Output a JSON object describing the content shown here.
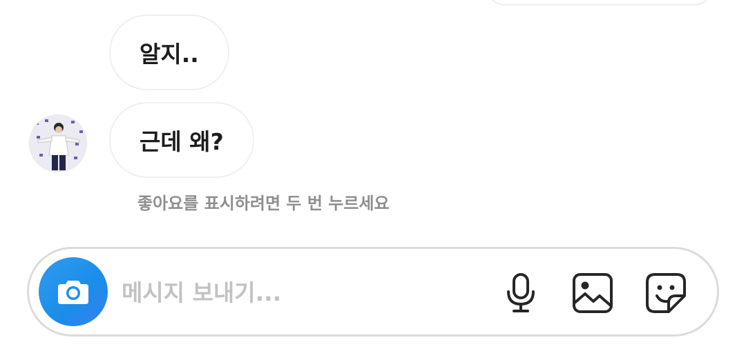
{
  "messages": [
    {
      "text": "알지.."
    },
    {
      "text": "근데 왜?"
    }
  ],
  "hint": "좋아요를 표시하려면 두 번 누르세요",
  "composer": {
    "placeholder": "메시지 보내기...",
    "icons": [
      "camera-icon",
      "microphone-icon",
      "gallery-icon",
      "sticker-icon"
    ]
  },
  "colors": {
    "camera_button": "#1a8de9",
    "bubble_border": "#efefef",
    "hint_text": "#8e8e8e",
    "placeholder": "#c2c2c2"
  }
}
